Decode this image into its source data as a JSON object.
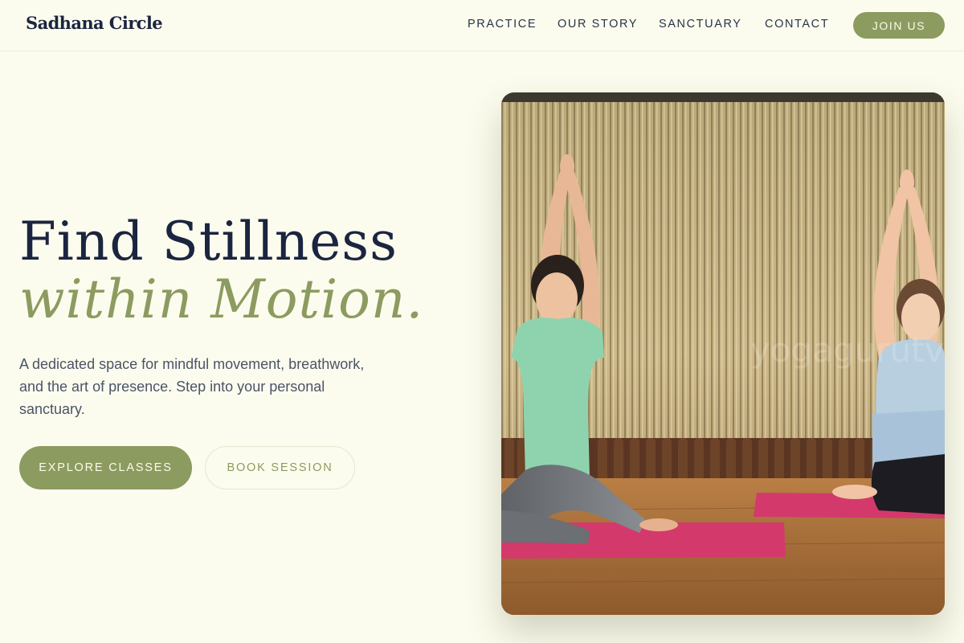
{
  "header": {
    "brand": "Sadhana Circle",
    "nav": [
      {
        "label": "PRACTICE"
      },
      {
        "label": "OUR STORY"
      },
      {
        "label": "SANCTUARY"
      },
      {
        "label": "CONTACT"
      }
    ],
    "cta_label": "JOIN US"
  },
  "hero": {
    "title_line1": "Find Stillness",
    "title_line2": "within Motion.",
    "description": "A dedicated space for mindful movement, breathwork, and the art of presence. Step into your personal sanctuary.",
    "primary_cta": "EXPLORE CLASSES",
    "secondary_cta": "BOOK SESSION",
    "image": {
      "subject": "two women in seated yoga poses with arms raised overhead on pink mats in front of a bamboo wall",
      "watermark": "yogagurutvork"
    }
  },
  "colors": {
    "background": "#fcfcee",
    "accent": "#8c9b5f",
    "heading": "#1b2540",
    "body_text": "#4a5468"
  }
}
